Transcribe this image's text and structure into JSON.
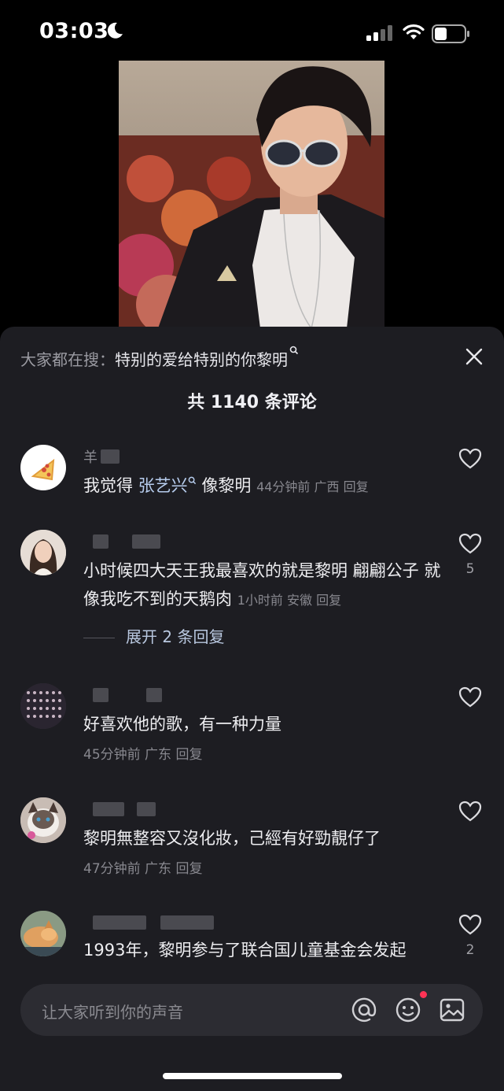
{
  "status_bar": {
    "time": "03:03",
    "icons": [
      "moon-icon",
      "signal-icon",
      "wifi-icon",
      "battery-icon"
    ]
  },
  "video": {
    "description": "video-frame"
  },
  "comments_panel": {
    "search_prefix": "大家都在搜：",
    "search_term": "特别的爱给特别的你黎明",
    "title": "共 1140 条评论",
    "comments": [
      {
        "username": "羊",
        "text_parts": [
          "我觉得 ",
          "张艺兴",
          " 像黎明"
        ],
        "time": "44分钟前",
        "location": "广西",
        "reply": "回复"
      },
      {
        "username": "",
        "text": "小时候四大天王我最喜欢的就是黎明  翩翩公子 就像我吃不到的天鹅肉",
        "time": "1小时前",
        "location": "安徽",
        "reply": "回复",
        "likes": "5",
        "expand": "展开 2 条回复"
      },
      {
        "username": "",
        "text": "好喜欢他的歌，有一种力量",
        "time": "45分钟前",
        "location": "广东",
        "reply": "回复"
      },
      {
        "username": "",
        "text": "黎明無整容又沒化妝，己經有好勁靚仔了",
        "time": "47分钟前",
        "location": "广东",
        "reply": "回复"
      },
      {
        "username": "",
        "text": "1993年，黎明参与了联合国儿童基金会发起",
        "likes": "2"
      }
    ],
    "input_placeholder": "让大家听到你的声音"
  },
  "colors": {
    "panel_bg": "#1d1d22",
    "link": "#b7cdee",
    "notification_dot": "#ff3355"
  }
}
